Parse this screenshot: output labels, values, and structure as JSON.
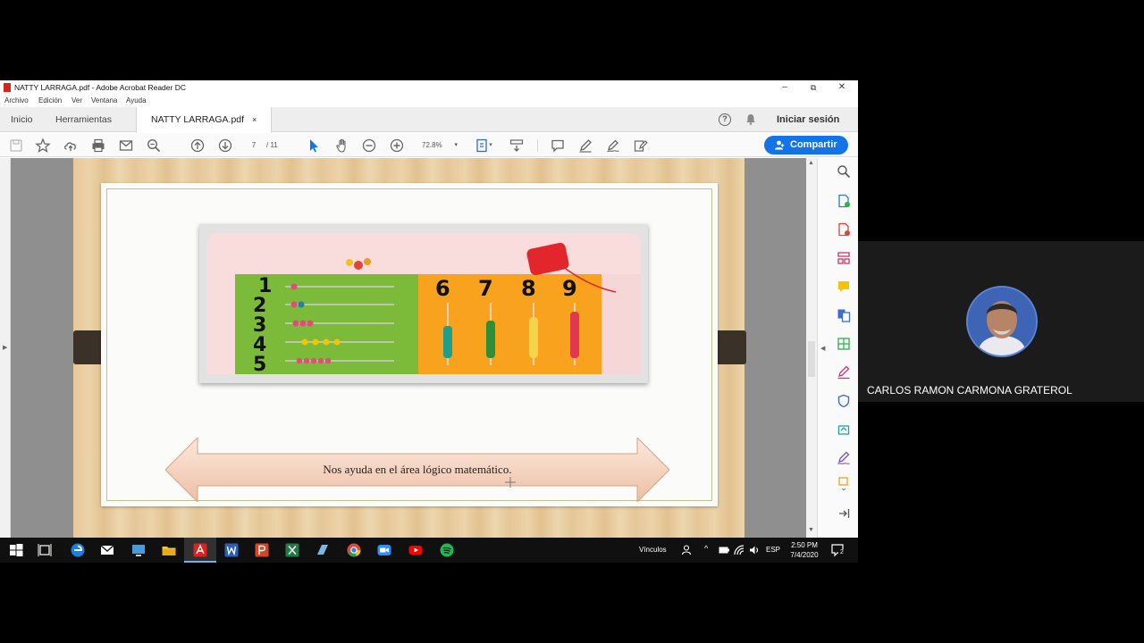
{
  "window": {
    "title": "NATTY LARRAGA.pdf - Adobe Acrobat Reader DC",
    "minimize": "–",
    "restore": "⧉",
    "close": "✕"
  },
  "menu": [
    "Archivo",
    "Edición",
    "Ver",
    "Ventana",
    "Ayuda"
  ],
  "tabs": {
    "home": "Inicio",
    "tools": "Herramientas",
    "document": "NATTY LARRAGA.pdf",
    "close_glyph": "×",
    "help_glyph": "?",
    "signin": "Iniciar sesión"
  },
  "toolbar": {
    "page_current": "7",
    "page_total": "/ 11",
    "zoom": "72.8%",
    "share": "Compartir"
  },
  "slide": {
    "banner_text": "Nos ayuda en el área lógico matemático.",
    "photo_numbers_left": [
      "1",
      "2",
      "3",
      "4",
      "5"
    ],
    "photo_numbers_right": [
      "6",
      "7",
      "8",
      "9"
    ]
  },
  "taskbar": {
    "links_label": "Vínculos",
    "language": "ESP",
    "time": "2:50 PM",
    "date": "7/4/2020",
    "notifications": "2"
  },
  "participant": {
    "name": "CARLOS RAMON CARMONA GRATEROL"
  },
  "colors": {
    "accent": "#1473e6",
    "acrobat_red": "#d8231e",
    "banner_fill": "#f3cdb6"
  }
}
